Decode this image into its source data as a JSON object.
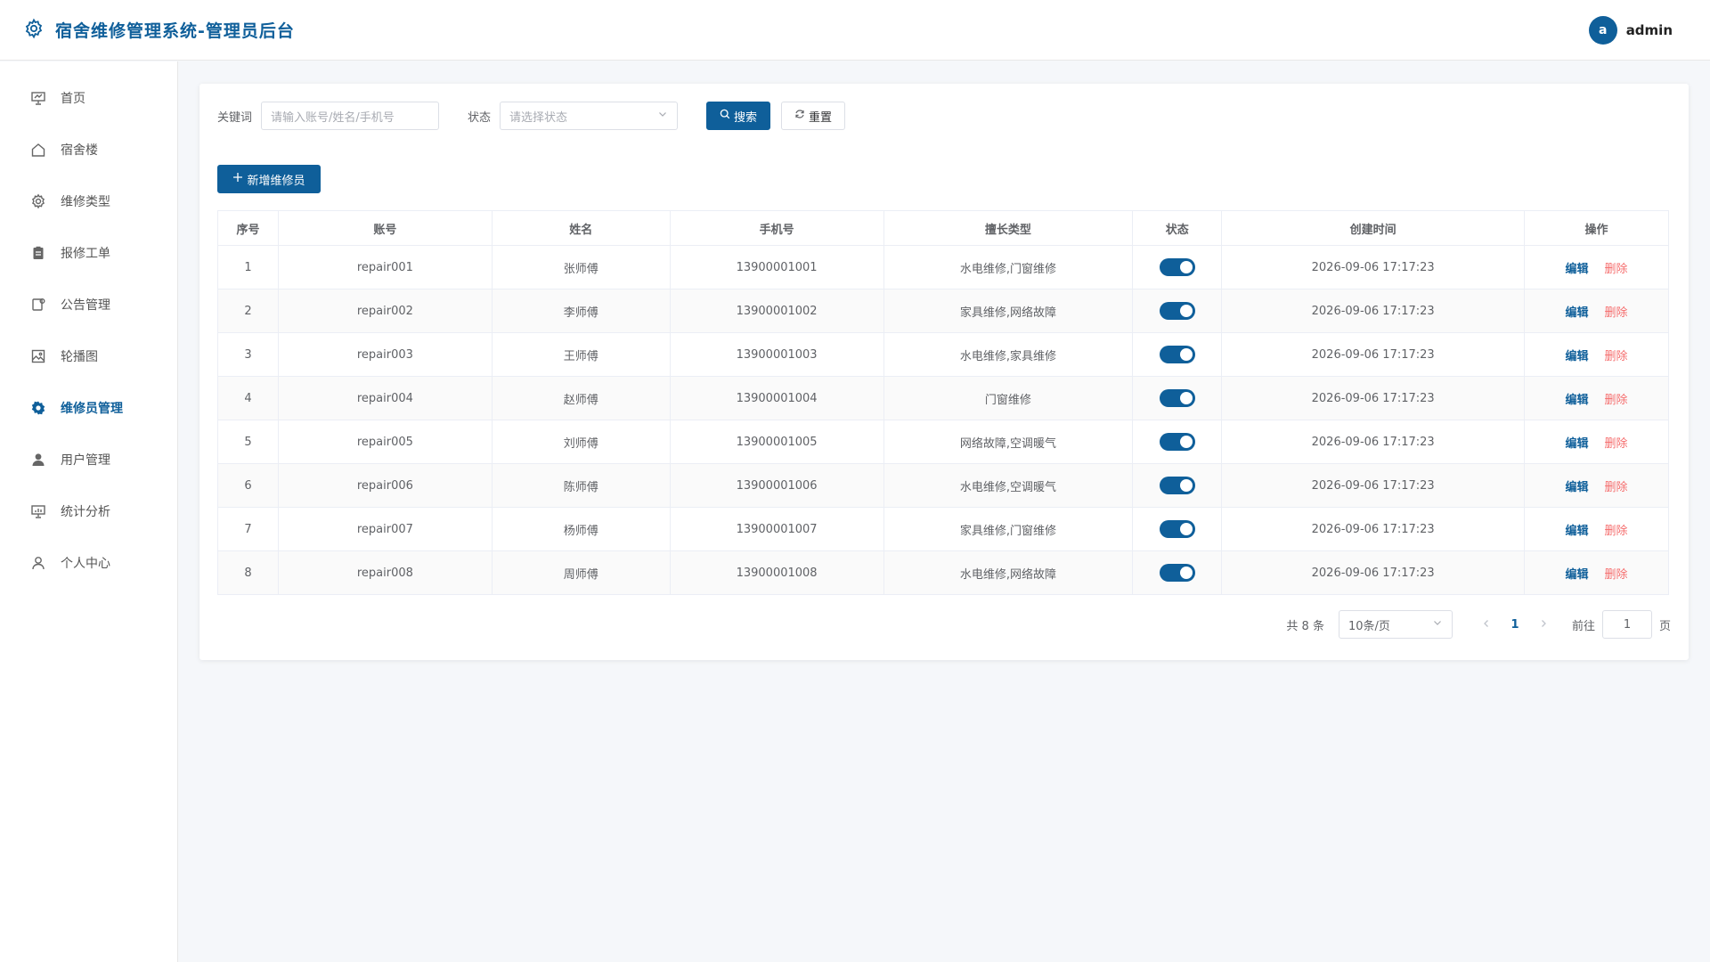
{
  "app": {
    "title": "宿舍维修管理系统-管理员后台"
  },
  "user": {
    "avatar_letter": "a",
    "name": "admin"
  },
  "colors": {
    "primary": "#0f5f9a",
    "danger": "#f56c6c"
  },
  "sidebar": {
    "items": [
      {
        "label": "首页",
        "icon": "dashboard-icon",
        "active": false
      },
      {
        "label": "宿舍楼",
        "icon": "home-icon",
        "active": false
      },
      {
        "label": "维修类型",
        "icon": "gear-icon",
        "active": false
      },
      {
        "label": "报修工单",
        "icon": "clipboard-icon",
        "active": false
      },
      {
        "label": "公告管理",
        "icon": "notice-icon",
        "active": false
      },
      {
        "label": "轮播图",
        "icon": "picture-icon",
        "active": false
      },
      {
        "label": "维修员管理",
        "icon": "tools-icon",
        "active": true
      },
      {
        "label": "用户管理",
        "icon": "user-filled-icon",
        "active": false
      },
      {
        "label": "统计分析",
        "icon": "chart-icon",
        "active": false
      },
      {
        "label": "个人中心",
        "icon": "user-icon",
        "active": false
      }
    ]
  },
  "filters": {
    "keyword_label": "关键词",
    "keyword_placeholder": "请输入账号/姓名/手机号",
    "status_label": "状态",
    "status_placeholder": "请选择状态",
    "search_label": "搜索",
    "reset_label": "重置"
  },
  "actions": {
    "add_label": "新增维修员"
  },
  "table": {
    "headers": [
      "序号",
      "账号",
      "姓名",
      "手机号",
      "擅长类型",
      "状态",
      "创建时间",
      "操作"
    ],
    "edit_label": "编辑",
    "delete_label": "删除",
    "rows": [
      {
        "no": "1",
        "account": "repair001",
        "name": "张师傅",
        "phone": "13900001001",
        "types": "水电维修,门窗维修",
        "enabled": true,
        "created": "2026-09-06 17:17:23"
      },
      {
        "no": "2",
        "account": "repair002",
        "name": "李师傅",
        "phone": "13900001002",
        "types": "家具维修,网络故障",
        "enabled": true,
        "created": "2026-09-06 17:17:23"
      },
      {
        "no": "3",
        "account": "repair003",
        "name": "王师傅",
        "phone": "13900001003",
        "types": "水电维修,家具维修",
        "enabled": true,
        "created": "2026-09-06 17:17:23"
      },
      {
        "no": "4",
        "account": "repair004",
        "name": "赵师傅",
        "phone": "13900001004",
        "types": "门窗维修",
        "enabled": true,
        "created": "2026-09-06 17:17:23"
      },
      {
        "no": "5",
        "account": "repair005",
        "name": "刘师傅",
        "phone": "13900001005",
        "types": "网络故障,空调暖气",
        "enabled": true,
        "created": "2026-09-06 17:17:23"
      },
      {
        "no": "6",
        "account": "repair006",
        "name": "陈师傅",
        "phone": "13900001006",
        "types": "水电维修,空调暖气",
        "enabled": true,
        "created": "2026-09-06 17:17:23"
      },
      {
        "no": "7",
        "account": "repair007",
        "name": "杨师傅",
        "phone": "13900001007",
        "types": "家具维修,门窗维修",
        "enabled": true,
        "created": "2026-09-06 17:17:23"
      },
      {
        "no": "8",
        "account": "repair008",
        "name": "周师傅",
        "phone": "13900001008",
        "types": "水电维修,网络故障",
        "enabled": true,
        "created": "2026-09-06 17:17:23"
      }
    ]
  },
  "pagination": {
    "total_text": "共 8 条",
    "page_size": "10条/页",
    "current_page": "1",
    "goto_label": "前往",
    "goto_value": "1",
    "page_unit": "页"
  }
}
